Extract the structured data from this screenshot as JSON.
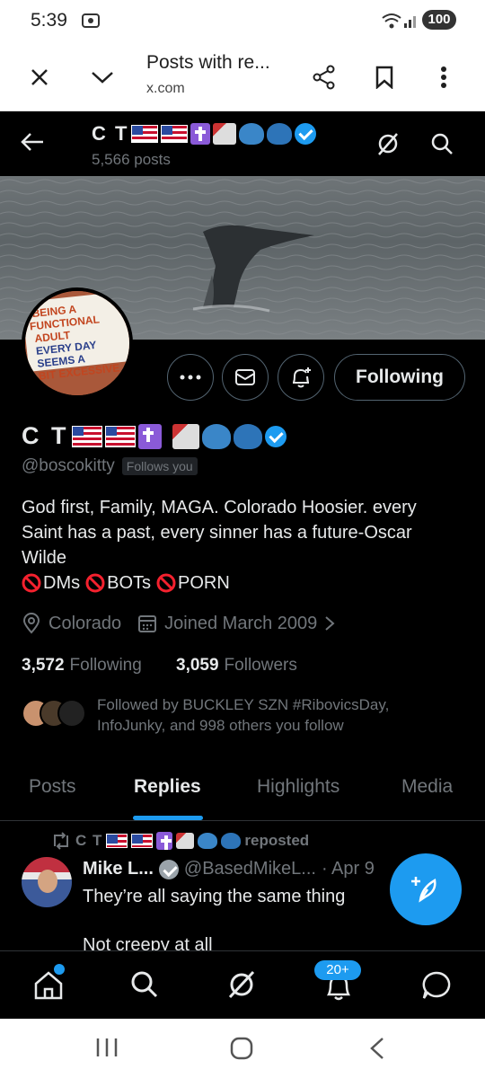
{
  "status": {
    "time": "5:39",
    "battery": "100"
  },
  "browser": {
    "title": "Posts with re...",
    "url": "x.com"
  },
  "header": {
    "name": "C T",
    "post_count": "5,566 posts"
  },
  "avatar_text": "BEING A FUNCTIONAL ADULT EVERY DAY SEEMS A BIT EXCESSIVE",
  "profile": {
    "name": "C T",
    "handle": "@boscokitty",
    "follows_you": "Follows you",
    "bio_line1": "God first, Family, MAGA. Colorado Hoosier. every",
    "bio_line2": "Saint has a past, every sinner has a future-Oscar",
    "bio_line3": "Wilde",
    "bio_dms": "DMs",
    "bio_bots": "BOTs",
    "bio_porn": "PORN",
    "location": "Colorado",
    "joined": "Joined March 2009",
    "following_count": "3,572",
    "following_label": "Following",
    "followers_count": "3,059",
    "followers_label": "Followers",
    "followed_by_line1": "Followed by BUCKLEY SZN #RibovicsDay,",
    "followed_by_line2": "InfoJunky, and 998 others you follow",
    "following_button": "Following"
  },
  "tabs": [
    "Posts",
    "Replies",
    "Highlights",
    "Media"
  ],
  "post": {
    "reposter": "C T",
    "reposted": "reposted",
    "author": "Mike L...",
    "handle": "@BasedMikeL...",
    "date": "· Apr 9",
    "text1": "They’re all saying the same thing",
    "text2": "Not creepy at all"
  },
  "nav": {
    "badge": "20+"
  },
  "colors": {
    "accent": "#1d9bf0",
    "background": "#000000",
    "muted": "#71767b",
    "no_symbol": "#f4212e"
  }
}
